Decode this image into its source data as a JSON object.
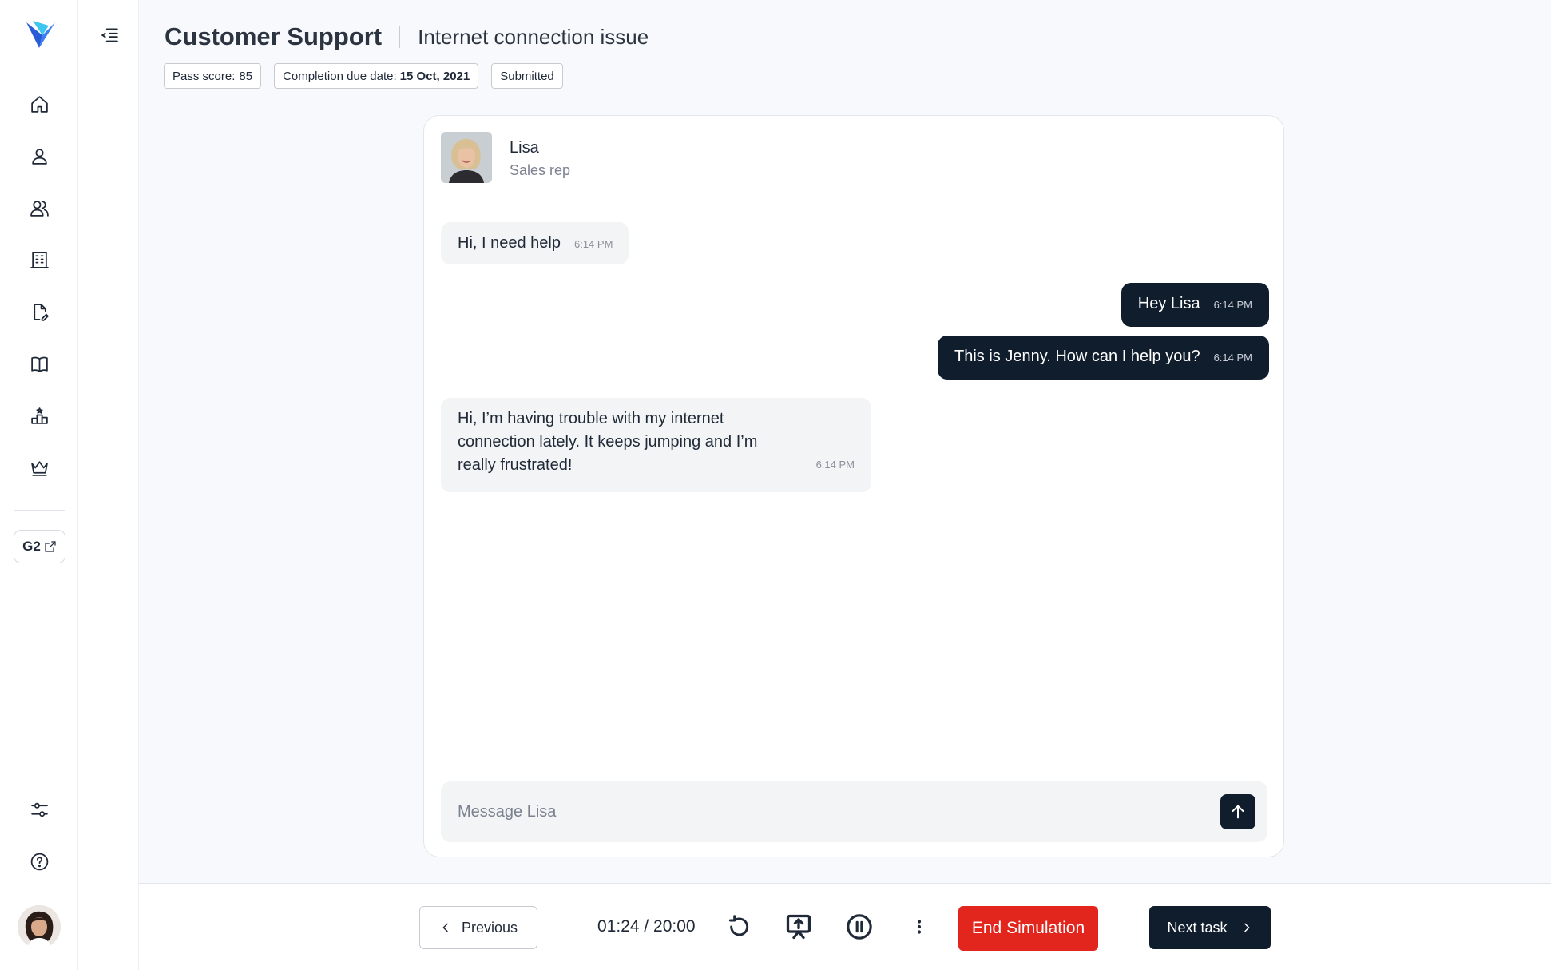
{
  "header": {
    "title": "Customer Support",
    "subtitle": "Internet connection issue",
    "badges": [
      {
        "label": "Pass score:",
        "value": "85"
      },
      {
        "label": "Completion due date:",
        "value": "15 Oct, 2021"
      },
      {
        "label": "Submitted",
        "value": ""
      }
    ]
  },
  "sidebar": {
    "items": [
      "home-icon",
      "user-icon",
      "users-icon",
      "building-icon",
      "file-edit-icon",
      "book-icon",
      "leaderboard-icon",
      "crown-icon"
    ],
    "g2_label": "G2",
    "bottom_items": [
      "sliders-icon",
      "help-icon"
    ]
  },
  "chat": {
    "contact": {
      "name": "Lisa",
      "role": "Sales rep"
    },
    "messages": [
      {
        "side": "in",
        "text": "Hi, I need help",
        "time": "6:14 PM"
      },
      {
        "side": "out",
        "text": "Hey Lisa",
        "time": "6:14 PM"
      },
      {
        "side": "out",
        "text": "This is Jenny. How can I help you?",
        "time": "6:14 PM"
      },
      {
        "side": "in",
        "text": "Hi, I’m having trouble with my internet connection lately. It keeps jumping and I’m really frustrated!",
        "time": "6:14 PM"
      }
    ],
    "composer_placeholder": "Message Lisa"
  },
  "footer": {
    "previous_label": "Previous",
    "timer": "01:24 / 20:00",
    "end_label": "End Simulation",
    "next_label": "Next task"
  },
  "colors": {
    "accent_dark": "#101d2c",
    "danger": "#e3261d",
    "logo_blue": "#2a5bd7",
    "logo_cyan": "#3ec6f0"
  }
}
